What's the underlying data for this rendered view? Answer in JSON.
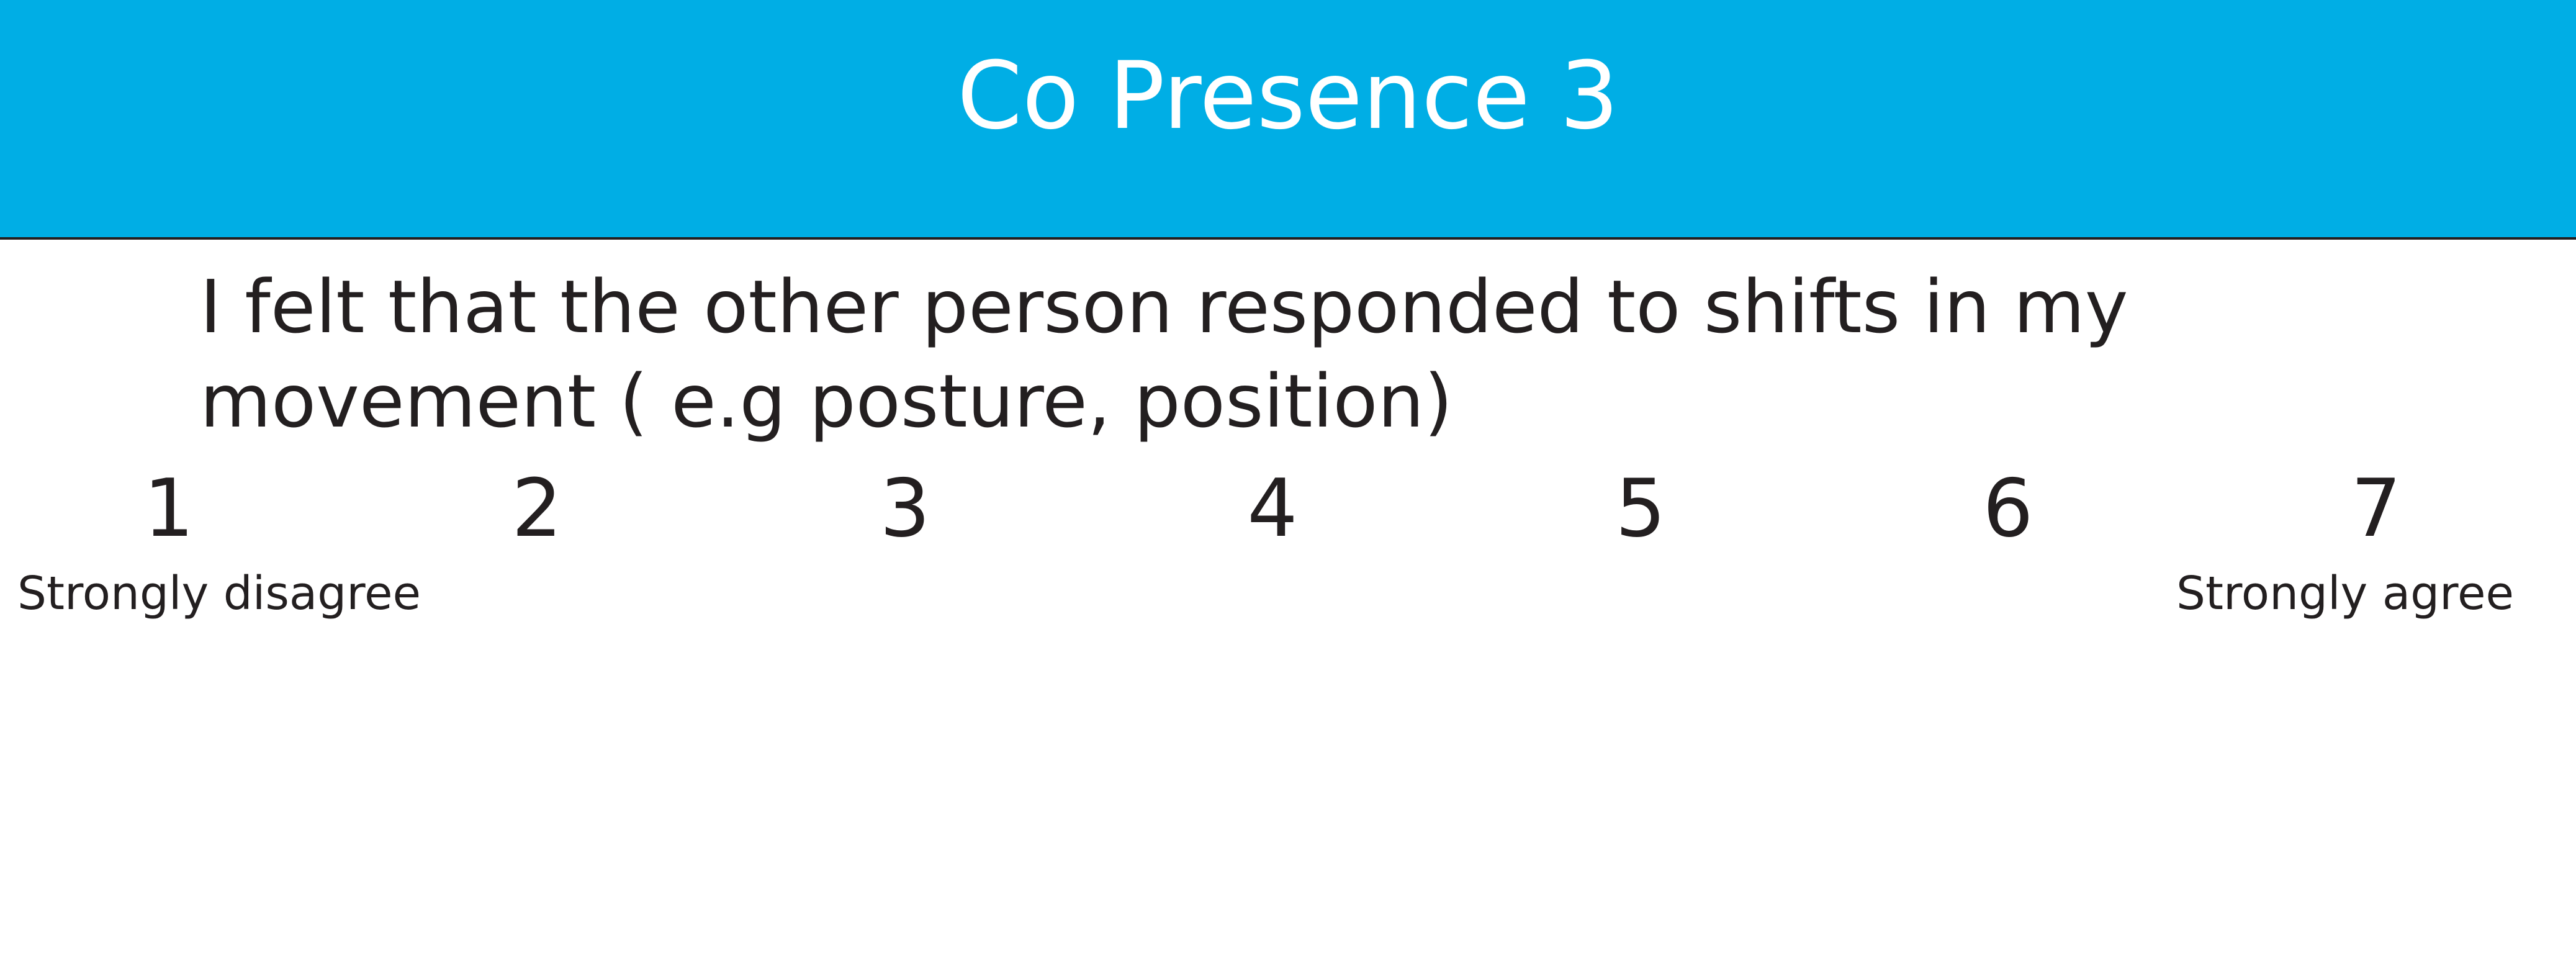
{
  "header": {
    "title": "Co Presence 3",
    "background_color": "#00aee5",
    "title_color": "#ffffff"
  },
  "question": {
    "text": "I felt that the other person responded to shifts in my movement ( e.g posture, position)"
  },
  "scale": {
    "points": [
      "1",
      "2",
      "3",
      "4",
      "5",
      "6",
      "7"
    ],
    "min_label": "Strongly disagree",
    "max_label": "Strongly agree"
  }
}
